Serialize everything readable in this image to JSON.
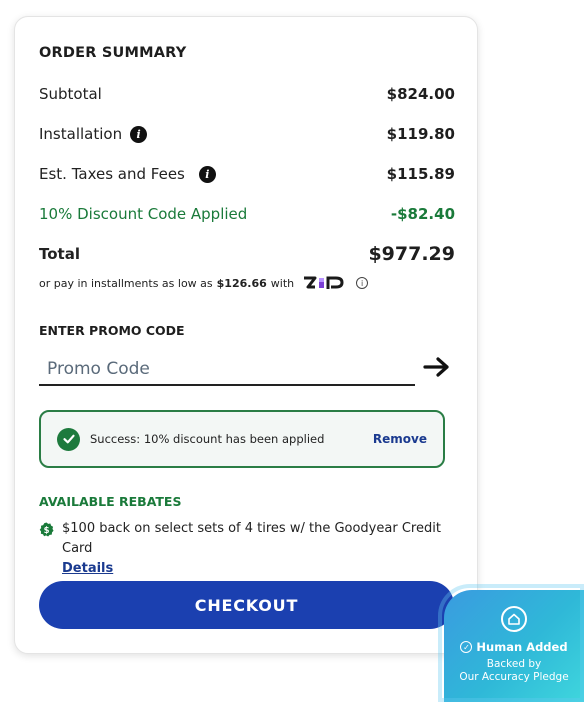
{
  "summary": {
    "title": "ORDER SUMMARY",
    "subtotal_label": "Subtotal",
    "subtotal_value": "$824.00",
    "installation_label": "Installation",
    "installation_value": "$119.80",
    "taxes_label": "Est. Taxes and Fees",
    "taxes_value": "$115.89",
    "discount_label": "10% Discount Code Applied",
    "discount_value": "-$82.40",
    "total_label": "Total",
    "total_value": "$977.29",
    "installments_prefix": "or pay in installments as low as",
    "installments_amount": "$126.66",
    "installments_with": "with",
    "installments_brand": "Zip"
  },
  "promo": {
    "title": "ENTER PROMO CODE",
    "placeholder": "Promo Code",
    "success_message": "Success: 10% discount has been applied",
    "remove_label": "Remove"
  },
  "rebates": {
    "title": "AVAILABLE REBATES",
    "item_text": "$100 back on select sets of 4 tires w/ the Goodyear Credit Card",
    "details_label": "Details"
  },
  "checkout": {
    "label": "CHECKOUT"
  },
  "pledge": {
    "title": "Human Added",
    "line1": "Backed by",
    "line2": "Our Accuracy Pledge"
  },
  "colors": {
    "accent_blue": "#1b40b0",
    "success_green": "#1a7a3a",
    "zip_purple": "#7b3fd6"
  },
  "icons": {
    "info": "info-icon",
    "arrow": "arrow-right-icon",
    "check": "check-circle-icon",
    "rebate": "dollar-badge-icon",
    "pledge": "home-shield-icon"
  }
}
